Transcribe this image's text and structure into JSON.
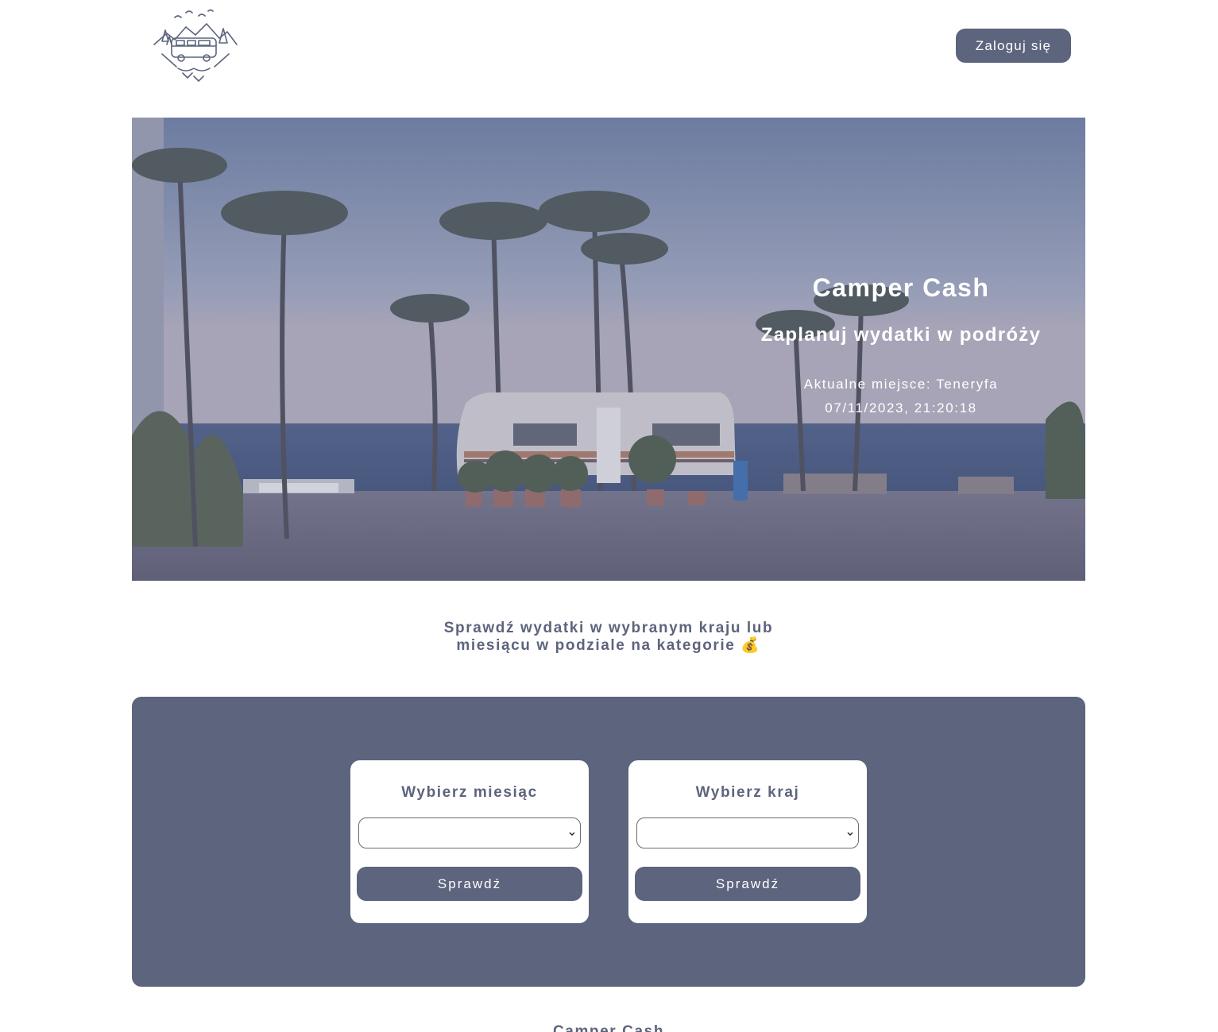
{
  "header": {
    "logo_icon": "camper-van-logo-icon",
    "login_label": "Zaloguj się"
  },
  "hero": {
    "title": "Camper Cash",
    "subtitle": "Zaplanuj wydatki w podróży",
    "place": "Aktualne miejsce: Teneryfa",
    "datetime": "07/11/2023, 21:20:18"
  },
  "intro": {
    "line1": "Sprawdź wydatki w wybranym kraju lub",
    "line2": "miesiącu w podziale na kategorie 💰"
  },
  "filters": {
    "month": {
      "title": "Wybierz miesiąc",
      "selected": "",
      "button": "Sprawdź"
    },
    "country": {
      "title": "Wybierz kraj",
      "selected": "",
      "button": "Sprawdź"
    }
  },
  "footer": {
    "title": "Camper Cash"
  },
  "colors": {
    "primary": "#5d647d",
    "background": "#ffffff"
  }
}
